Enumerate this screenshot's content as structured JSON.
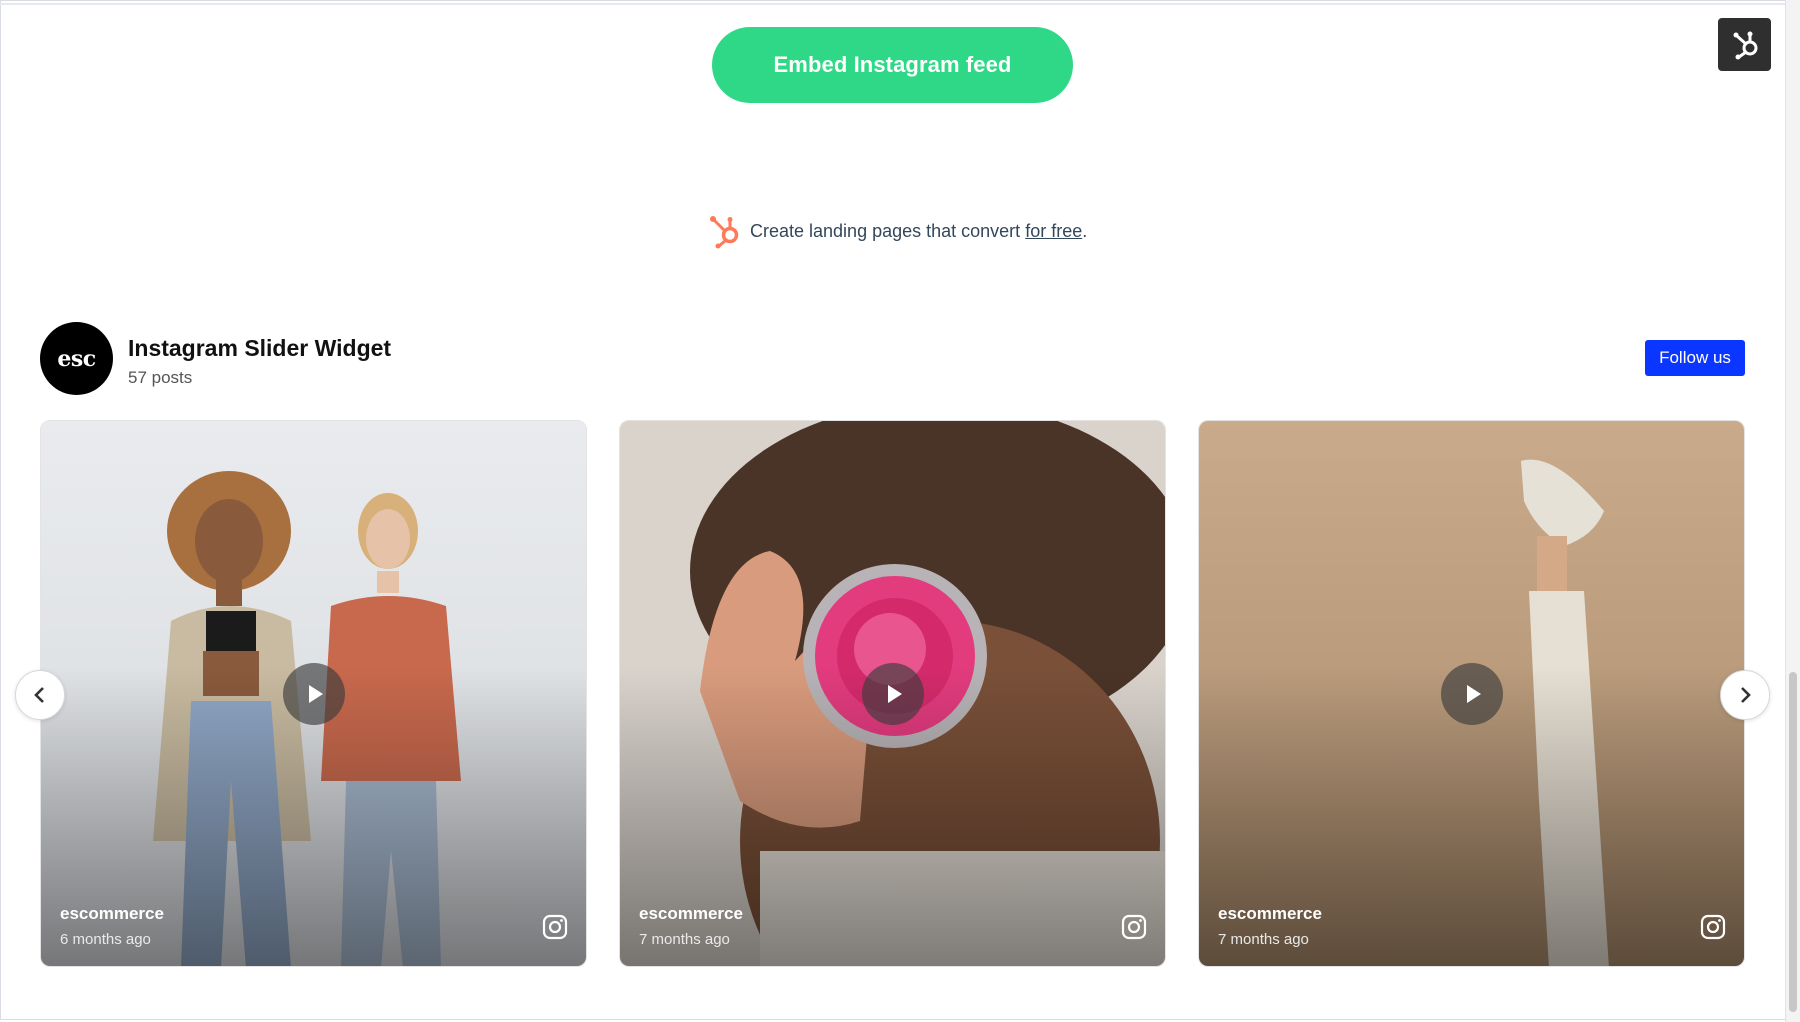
{
  "embed_button": {
    "label": "Embed Instagram feed"
  },
  "promo": {
    "text": "Create landing pages that convert",
    "link": "for free",
    "suffix": "."
  },
  "widget": {
    "avatar_text": "esc",
    "title": "Instagram Slider Widget",
    "post_count": "57 posts",
    "follow_label": "Follow us"
  },
  "posts": [
    {
      "username": "escommerce",
      "time": "6 months ago"
    },
    {
      "username": "escommerce",
      "time": "7 months ago"
    },
    {
      "username": "escommerce",
      "time": "7 months ago"
    }
  ],
  "colors": {
    "embed_green": "#2fd886",
    "follow_blue": "#0b36ff",
    "hubspot_orange": "#ff7a59"
  },
  "icons": {
    "hubspot": "hubspot-sprocket-icon",
    "play": "play-icon",
    "instagram": "instagram-icon",
    "prev": "chevron-left-icon",
    "next": "chevron-right-icon"
  }
}
